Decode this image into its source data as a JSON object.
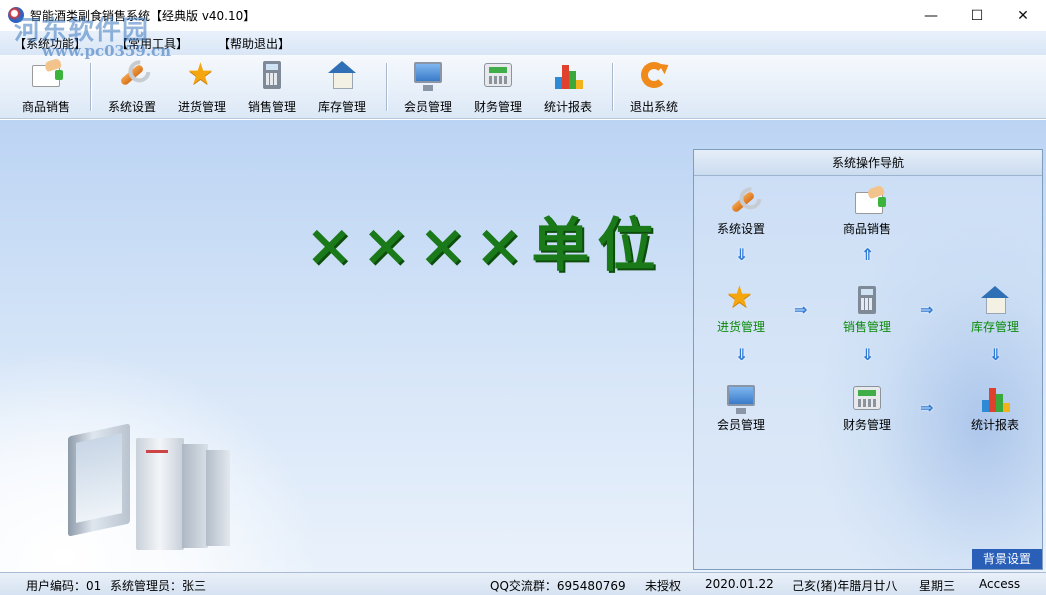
{
  "window": {
    "title": "智能酒类副食销售系统【经典版 v40.10】",
    "controls": {
      "minimize": "—",
      "maximize": "☐",
      "close": "✕"
    }
  },
  "watermark": {
    "line1": "河东软件园",
    "line2": "www.pc0359.cn"
  },
  "menu": {
    "items": [
      "【系统功能】",
      "【常用工具】",
      "【帮助退出】"
    ]
  },
  "toolbar": {
    "items": [
      {
        "label": "商品销售",
        "icon": "hand-receipt-icon"
      },
      {
        "label": "系统设置",
        "icon": "wrench-icon"
      },
      {
        "label": "进货管理",
        "icon": "star-icon"
      },
      {
        "label": "销售管理",
        "icon": "calculator-icon"
      },
      {
        "label": "库存管理",
        "icon": "house-icon"
      },
      {
        "label": "会员管理",
        "icon": "monitor-icon"
      },
      {
        "label": "财务管理",
        "icon": "cash-register-icon"
      },
      {
        "label": "统计报表",
        "icon": "bar-chart-icon"
      },
      {
        "label": "退出系统",
        "icon": "refresh-icon"
      }
    ]
  },
  "main": {
    "unit_title": "××××单位"
  },
  "navigator": {
    "title": "系统操作导航",
    "nodes": {
      "settings": "系统设置",
      "sales": "商品销售",
      "purchase": "进货管理",
      "sales_mgmt": "销售管理",
      "inventory": "库存管理",
      "members": "会员管理",
      "finance": "财务管理",
      "reports": "统计报表"
    },
    "background_button": "背景设置"
  },
  "statusbar": {
    "user_code": "用户编码：01",
    "admin": "系统管理员：张三",
    "qq": "QQ交流群：695480769",
    "license": "未授权",
    "date": "2020.01.22",
    "lunar": "己亥(猪)年腊月廿八",
    "weekday": "星期三",
    "db": "Access"
  },
  "colors": {
    "accent_blue": "#2a5fb8",
    "title_green": "#1a7a1a",
    "nav_green": "#0a8a0a"
  }
}
